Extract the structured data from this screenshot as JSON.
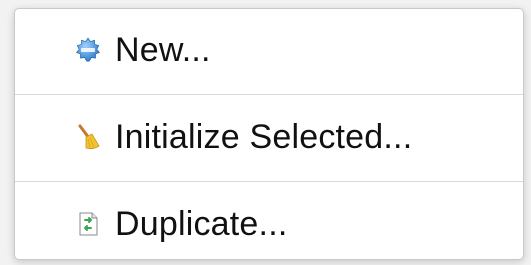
{
  "menu": {
    "items": [
      {
        "label": "New...",
        "icon": "new-badge-icon"
      },
      {
        "label": "Initialize Selected...",
        "icon": "broom-icon"
      },
      {
        "label": "Duplicate...",
        "icon": "duplicate-document-icon"
      }
    ]
  },
  "colors": {
    "menu_background": "#ffffff",
    "separator": "#d9d9d9",
    "text": "#111111",
    "new_badge": "#3a8fd6",
    "broom_handle": "#c47a2c",
    "broom_bristles": "#f2c230",
    "duplicate_arrow": "#3aa655"
  }
}
